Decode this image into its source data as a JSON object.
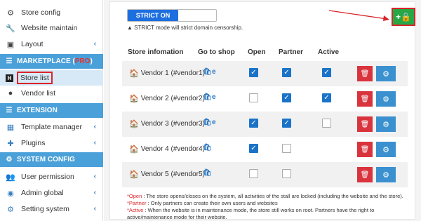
{
  "sidebar": {
    "items": [
      {
        "label": "Store config",
        "icon": "gear-icon"
      },
      {
        "label": "Website maintain",
        "icon": "wrench-icon"
      },
      {
        "label": "Layout",
        "icon": "image-icon"
      }
    ],
    "marketplace": {
      "title": "MARKETPLACE (",
      "pro": "PRO",
      "close": ")"
    },
    "marketplace_items": [
      {
        "label": "Store list",
        "icon": "store-icon"
      },
      {
        "label": "Vendor list",
        "icon": "user-icon"
      }
    ],
    "extension": {
      "title": "EXTENSION"
    },
    "extension_items": [
      {
        "label": "Template manager",
        "icon": "grid-icon"
      },
      {
        "label": "Plugins",
        "icon": "puzzle-icon"
      }
    ],
    "system": {
      "title": "SYSTEM CONFIG"
    },
    "system_items": [
      {
        "label": "User permission",
        "icon": "users-icon"
      },
      {
        "label": "Admin global",
        "icon": "user-circle-icon"
      },
      {
        "label": "Setting system",
        "icon": "cogs-icon"
      }
    ]
  },
  "strict": {
    "label": "STRICT ON",
    "note": "STRICT mode will strict domain censorship."
  },
  "table": {
    "headers": {
      "store": "Store infomation",
      "shop": "Go to shop",
      "open": "Open",
      "partner": "Partner",
      "active": "Active"
    },
    "rows": [
      {
        "name": "Vendor 1 (#vendor1)",
        "open": true,
        "partner": true,
        "active": true,
        "shop_icons": 2
      },
      {
        "name": "Vendor 2 (#vendor2)",
        "open": false,
        "partner": true,
        "active": true,
        "shop_icons": 2
      },
      {
        "name": "Vendor 3 (#vendor3)",
        "open": true,
        "partner": true,
        "active": false,
        "shop_icons": 2
      },
      {
        "name": "Vendor 4 (#vendor4)",
        "open": true,
        "partner": false,
        "active": null,
        "shop_icons": 1
      },
      {
        "name": "Vendor 5 (#vendor5)",
        "open": false,
        "partner": false,
        "active": null,
        "shop_icons": 1
      }
    ]
  },
  "notes": {
    "open_key": "*Open",
    "open_text": " : The store opens/closes on the system, all activities of the stall are locked (including the website and the store).",
    "partner_key": "*Partner",
    "partner_text": " : Only partners can create their own users and websites",
    "active_key": "*Active",
    "active_text": " : When the website is in maintenance mode, the store still works on root. Partners have the right to active/maintenance mode for their website."
  },
  "colors": {
    "accent": "#4aa0d8",
    "add_button": "#27a845",
    "delete": "#d9343e",
    "config": "#3b91cf",
    "checked": "#1a73c8"
  }
}
